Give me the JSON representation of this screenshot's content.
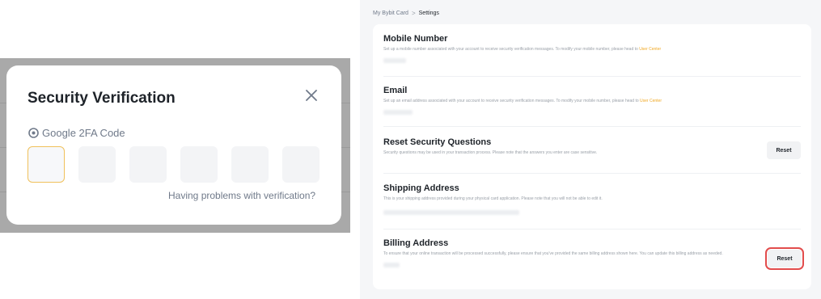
{
  "modal": {
    "title": "Security Verification",
    "code_label": "Google 2FA Code",
    "code_boxes": 6,
    "help_text": "Having problems with verification?"
  },
  "settings": {
    "breadcrumb": {
      "parent": "My Bybit Card",
      "separator": ">",
      "current": "Settings"
    },
    "sections": {
      "mobile": {
        "title": "Mobile Number",
        "desc": "Set up a mobile number associated with your account to receive security verification messages. To modify your mobile number, please head to ",
        "link": "User Center"
      },
      "email": {
        "title": "Email",
        "desc": "Set up an email address associated with your account to receive security verification messages. To modify your mobile number, please head to ",
        "link": "User Center"
      },
      "questions": {
        "title": "Reset Security Questions",
        "desc": "Security questions may be used in your transaction process. Please note that the answers you enter are case sensitive.",
        "button": "Reset"
      },
      "shipping": {
        "title": "Shipping Address",
        "desc": "This is your shipping address provided during your physical card application. Please note that you will not be able to edit it."
      },
      "billing": {
        "title": "Billing Address",
        "desc": "To ensure that your online transaction will be processed successfully, please ensure that you've provided the same billing address shown here. You can update this billing address as needed.",
        "button": "Reset"
      }
    }
  },
  "colors": {
    "accent": "#f0c15b",
    "link": "#f0a823",
    "highlight": "#e24c4c",
    "text": "#1e2329"
  }
}
